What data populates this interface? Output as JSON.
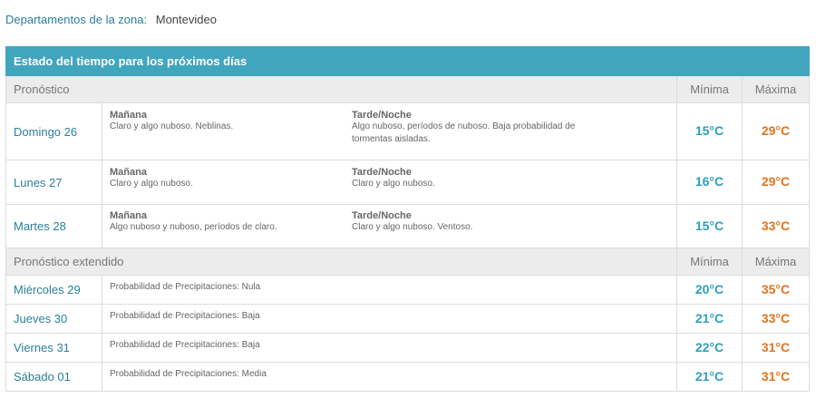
{
  "zone": {
    "label": "Departamentos de la zona:",
    "value": "Montevideo"
  },
  "table_title": "Estado del tiempo para los próximos días",
  "forecast_header": {
    "label": "Pronóstico",
    "min": "Mínima",
    "max": "Máxima"
  },
  "days": [
    {
      "day": "Domingo 26",
      "morning_title": "Mañana",
      "morning_text": "Claro y algo nuboso. Neblinas.",
      "evening_title": "Tarde/Noche",
      "evening_text": "Algo nuboso, períodos de nuboso. Baja probabilidad de tormentas aisladas.",
      "min": "15°C",
      "max": "29°C"
    },
    {
      "day": "Lunes 27",
      "morning_title": "Mañana",
      "morning_text": "Claro y algo nuboso.",
      "evening_title": "Tarde/Noche",
      "evening_text": "Claro y algo nuboso.",
      "min": "16°C",
      "max": "29°C"
    },
    {
      "day": "Martes 28",
      "morning_title": "Mañana",
      "morning_text": "Algo nuboso y nuboso, períodos de claro.",
      "evening_title": "Tarde/Noche",
      "evening_text": "Claro y algo nuboso. Ventoso.",
      "min": "15°C",
      "max": "33°C"
    }
  ],
  "extended_header": {
    "label": "Pronóstico extendido",
    "min": "Mínima",
    "max": "Máxima"
  },
  "extended": [
    {
      "day": "Miércoles 29",
      "text": "Probabilidad de Precipitaciones: Nula",
      "min": "20°C",
      "max": "35°C"
    },
    {
      "day": "Jueves 30",
      "text": "Probabilidad de Precipitaciones: Baja",
      "min": "21°C",
      "max": "33°C"
    },
    {
      "day": "Viernes 31",
      "text": "Probabilidad de Precipitaciones: Baja",
      "min": "22°C",
      "max": "31°C"
    },
    {
      "day": "Sábado 01",
      "text": "Probabilidad de Precipitaciones: Media",
      "min": "21°C",
      "max": "31°C"
    }
  ]
}
